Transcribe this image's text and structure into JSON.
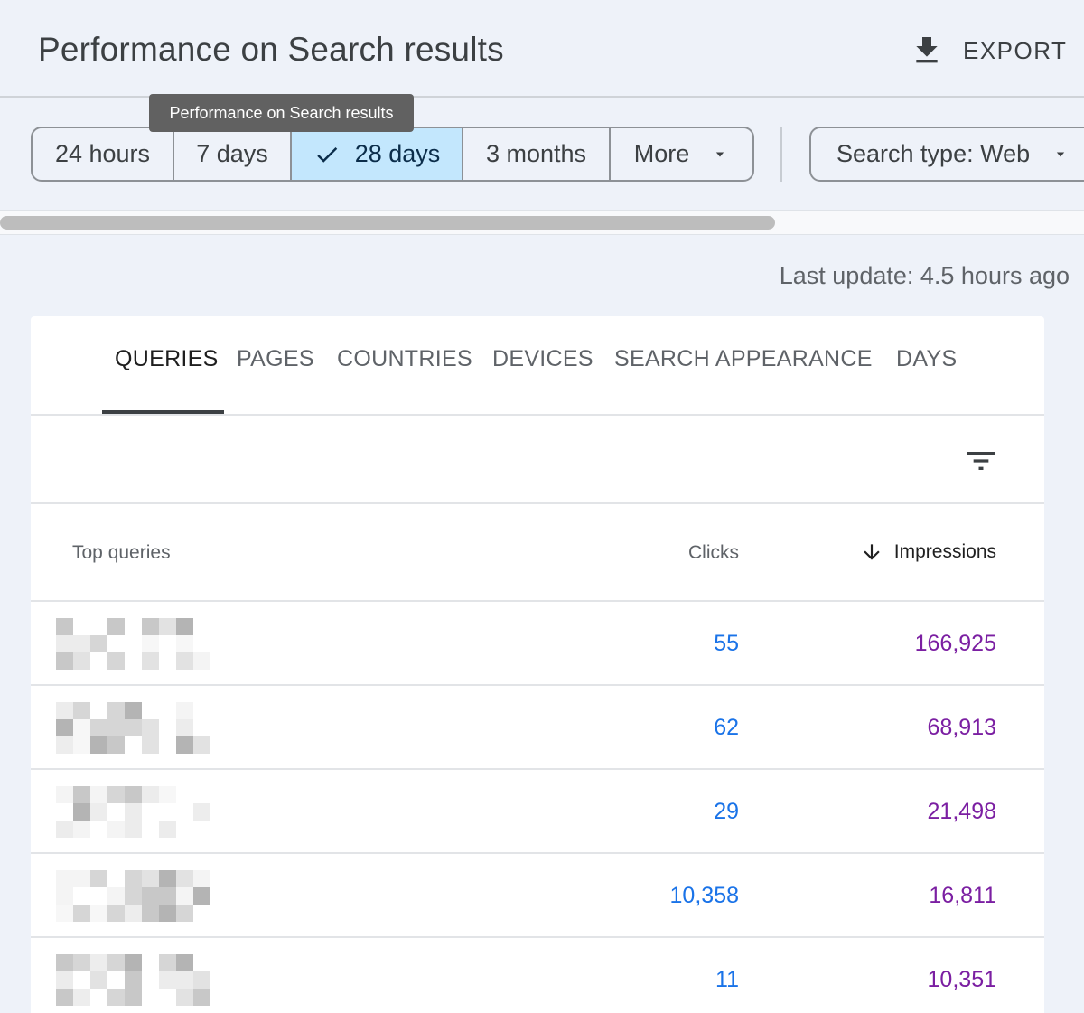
{
  "header": {
    "title": "Performance on Search results",
    "export_label": "EXPORT",
    "export_icon": "download-icon"
  },
  "filters": {
    "tooltip": "Performance on Search results",
    "date_ranges": [
      {
        "label": "24 hours",
        "selected": false
      },
      {
        "label": "7 days",
        "selected": false
      },
      {
        "label": "28 days",
        "selected": true
      },
      {
        "label": "3 months",
        "selected": false
      },
      {
        "label": "More",
        "selected": false
      }
    ],
    "search_type": "Search type: Web",
    "selected_color": "#c3e7fd"
  },
  "last_update": "Last update: 4.5 hours ago",
  "tabs": [
    {
      "label": "QUERIES",
      "active": true
    },
    {
      "label": "PAGES",
      "active": false
    },
    {
      "label": "COUNTRIES",
      "active": false
    },
    {
      "label": "DEVICES",
      "active": false
    },
    {
      "label": "SEARCH APPEARANCE",
      "active": false
    },
    {
      "label": "DAYS",
      "active": false
    }
  ],
  "table": {
    "columns": {
      "query": "Top queries",
      "clicks": "Clicks",
      "impressions": "Impressions"
    },
    "sort": {
      "column": "impressions",
      "direction": "descending"
    },
    "clicks_color": "#1a73e8",
    "impressions_color": "#7b1fa2",
    "rows": [
      {
        "clicks": "55",
        "impressions": "166,925"
      },
      {
        "clicks": "62",
        "impressions": "68,913"
      },
      {
        "clicks": "29",
        "impressions": "21,498"
      },
      {
        "clicks": "10,358",
        "impressions": "16,811"
      },
      {
        "clicks": "11",
        "impressions": "10,351"
      }
    ]
  }
}
